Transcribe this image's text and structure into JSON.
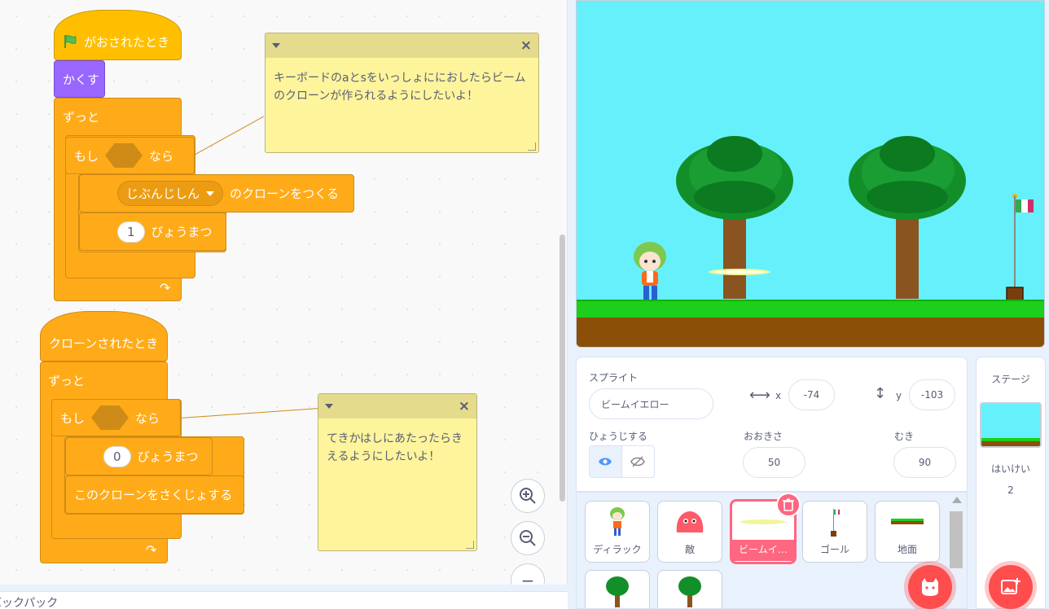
{
  "workspace": {
    "script1": {
      "hat": "がおされたとき",
      "hide": "かくす",
      "forever": "ずっと",
      "if_label": "もし",
      "then_label": "なら",
      "clone_dropdown": "じぶんじしん",
      "clone_label": "のクローンをつくる",
      "wait_value": "1",
      "wait_label": "びょうまつ"
    },
    "script2": {
      "hat": "クローンされたとき",
      "forever": "ずっと",
      "if_label": "もし",
      "then_label": "なら",
      "wait_value": "0",
      "wait_label": "びょうまつ",
      "delete_label": "このクローンをさくじょする"
    },
    "comment1": "キーボードのaとsをいっしょににおしたらビームのクローンが作られるようにしたいよ！",
    "comment2": "てきかはしにあたったらきえるようにしたいよ！",
    "zoom_in": "⊕",
    "zoom_out": "⊖",
    "zoom_reset": "−"
  },
  "backpack": {
    "label": "バックパック"
  },
  "sprite_info": {
    "sprite_label": "スプライト",
    "sprite_name": "ビームイエロー",
    "x_label": "x",
    "x_value": "-74",
    "y_label": "y",
    "y_value": "-103",
    "show_label": "ひょうじする",
    "size_label": "おおきさ",
    "size_value": "50",
    "direction_label": "むき",
    "direction_value": "90"
  },
  "sprites": [
    {
      "name": "ディラック"
    },
    {
      "name": "敵"
    },
    {
      "name": "ビームイ…",
      "selected": true
    },
    {
      "name": "ゴール"
    },
    {
      "name": "地面"
    },
    {
      "name": ""
    },
    {
      "name": ""
    }
  ],
  "stage_panel": {
    "title": "ステージ",
    "backdrops_label": "はいけい",
    "backdrops_count": "2"
  },
  "colors": {
    "control": "#ffab19",
    "events": "#ffbf00",
    "looks": "#9966ff",
    "stage_sky": "#66f0fb",
    "selected": "#ff6680",
    "fab": "#ff4c4c"
  }
}
